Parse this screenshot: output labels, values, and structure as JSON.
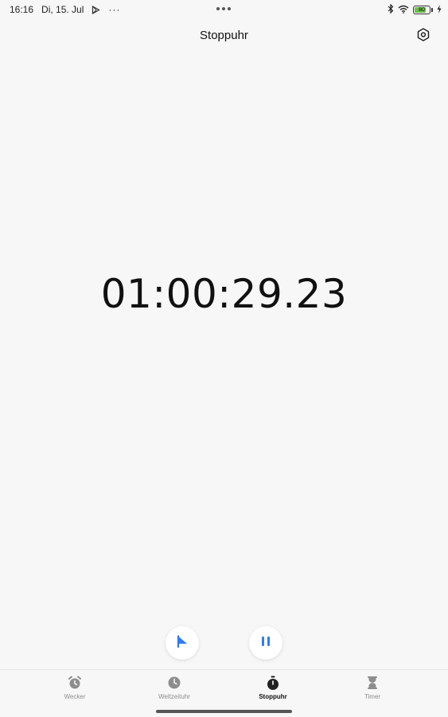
{
  "status_bar": {
    "time": "16:16",
    "date": "Di, 15. Jul",
    "more": "···",
    "battery_level": "80",
    "battery_percent": 0.8,
    "battery_color": "#6cc04a"
  },
  "header": {
    "title": "Stoppuhr",
    "settings_icon": "settings-hexagon-icon"
  },
  "stopwatch": {
    "elapsed": "01:00:29.23"
  },
  "controls": {
    "lap_icon": "flag-icon",
    "pause_icon": "pause-icon",
    "accent_color": "#2f7bf5"
  },
  "nav": {
    "items": [
      {
        "label": "Wecker",
        "icon": "alarm-clock-icon",
        "active": false
      },
      {
        "label": "Weltzeituhr",
        "icon": "clock-icon",
        "active": false
      },
      {
        "label": "Stoppuhr",
        "icon": "stopwatch-icon",
        "active": true
      },
      {
        "label": "Timer",
        "icon": "hourglass-icon",
        "active": false
      }
    ]
  }
}
